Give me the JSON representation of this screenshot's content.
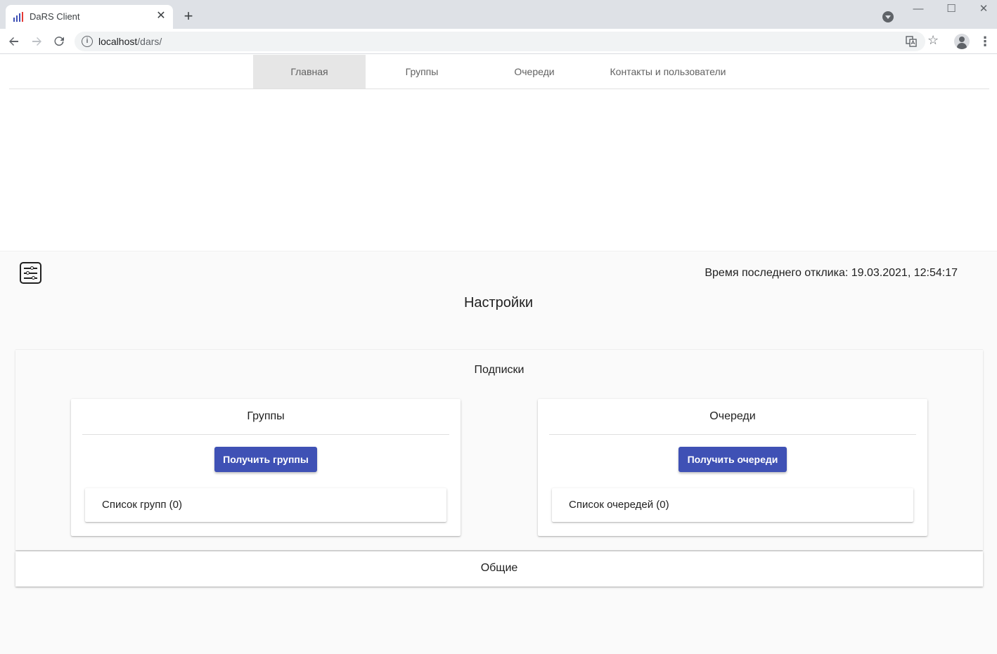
{
  "browser": {
    "tab_title": "DaRS Client",
    "tab_close": "✕",
    "new_tab": "+",
    "url_host": "localhost",
    "url_path": "/dars/",
    "window_controls": {
      "minimize": "—",
      "maximize": "☐",
      "close": "✕"
    },
    "icons": [
      "back-arrow-icon",
      "forward-arrow-icon",
      "reload-icon",
      "info-icon",
      "translate-icon",
      "star-icon",
      "profile-icon",
      "menu-icon"
    ]
  },
  "nav": {
    "tabs": [
      {
        "label": "Главная",
        "active": true
      },
      {
        "label": "Группы",
        "active": false
      },
      {
        "label": "Очереди",
        "active": false
      },
      {
        "label": "Контакты и пользователи",
        "active": false
      }
    ]
  },
  "settings": {
    "last_response": "Время последнего отклика: 19.03.2021, 12:54:17",
    "title": "Настройки",
    "subscriptions": {
      "title": "Подписки",
      "groups": {
        "title": "Группы",
        "button": "Получить группы",
        "list_label": "Список групп (0)"
      },
      "queues": {
        "title": "Очереди",
        "button": "Получить очереди",
        "list_label": "Список очередей (0)"
      }
    },
    "general": {
      "title": "Общие"
    }
  },
  "colors": {
    "accent": "#3f51b5",
    "active_tab_bg": "#e6e6e6",
    "settings_bg": "#fafafa"
  }
}
